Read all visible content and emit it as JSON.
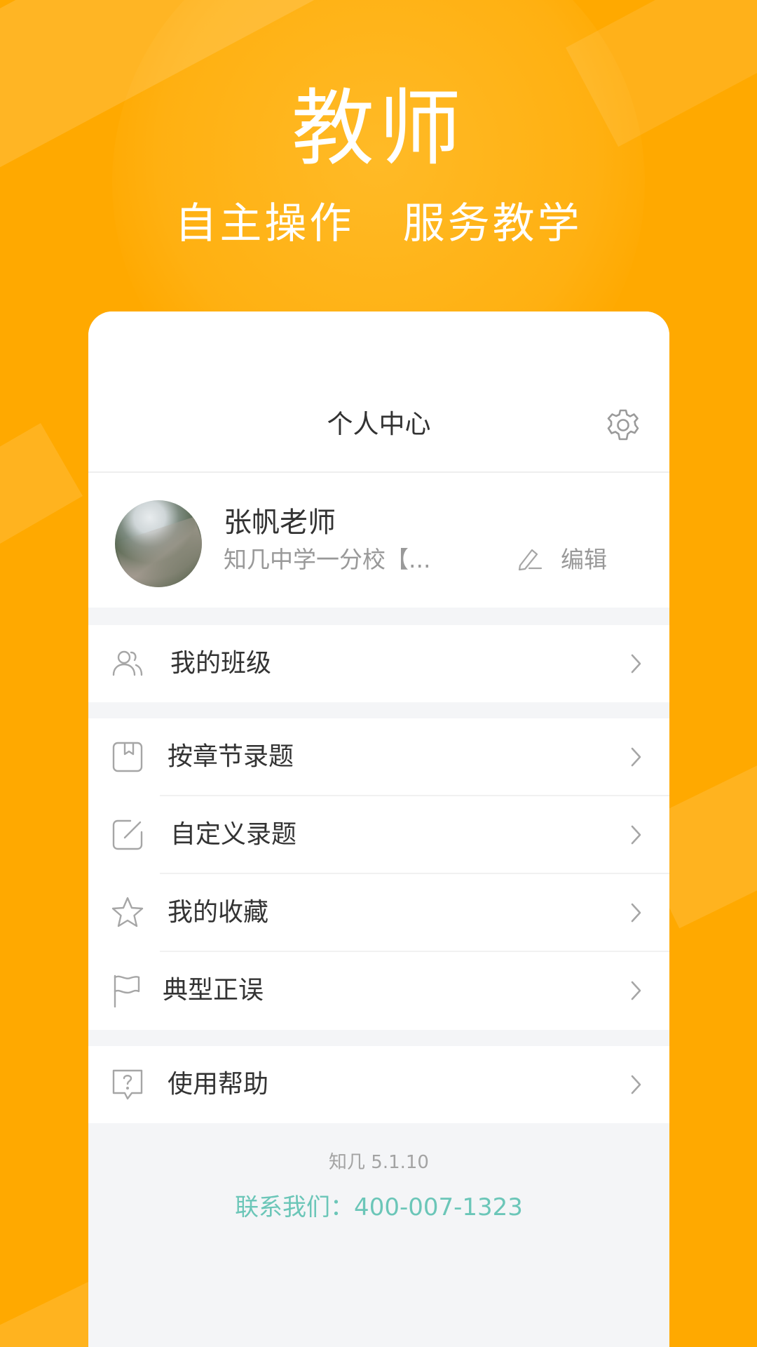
{
  "hero": {
    "title": "教师",
    "subtitle": "自主操作   服务教学"
  },
  "nav": {
    "title": "个人中心",
    "settings_icon": "gear-icon"
  },
  "profile": {
    "name": "张帆老师",
    "school": "知几中学一分校【...",
    "edit_label": "编辑"
  },
  "menu": {
    "group1": [
      {
        "label": "我的班级",
        "icon": "users-icon"
      }
    ],
    "group2": [
      {
        "label": "按章节录题",
        "icon": "bookmark-book-icon"
      },
      {
        "label": "自定义录题",
        "icon": "edit-square-icon"
      },
      {
        "label": "我的收藏",
        "icon": "star-icon"
      },
      {
        "label": "典型正误",
        "icon": "flag-icon"
      }
    ],
    "group3": [
      {
        "label": "使用帮助",
        "icon": "help-question-icon"
      }
    ]
  },
  "footer": {
    "version": "知几 5.1.10",
    "contact": "联系我们：400-007-1323"
  },
  "colors": {
    "background": "#FFA900",
    "accent_contact": "#6BC6B8",
    "card_bg": "#F4F5F7"
  }
}
